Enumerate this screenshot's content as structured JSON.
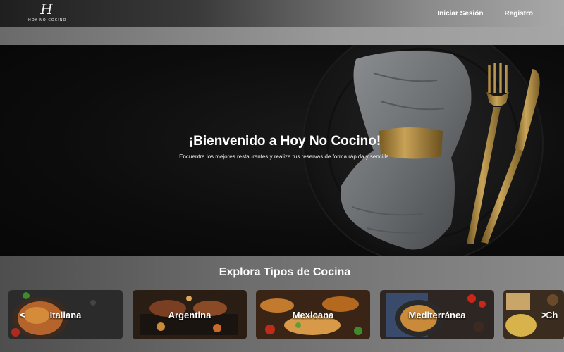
{
  "header": {
    "logo_mark": "H",
    "logo_text": "HOY NO COCINO",
    "nav": {
      "login_label": "Iniciar Sesión",
      "register_label": "Registro"
    }
  },
  "hero": {
    "title": "¡Bienvenido a Hoy No Cocino!",
    "subtitle": "Encuentra los mejores restaurantes y realiza tus reservas de forma rápida y sencilla."
  },
  "cuisines": {
    "section_title": "Explora Tipos de Cocina",
    "prev_label": "<",
    "next_label": ">",
    "items": [
      {
        "label": "Italiana"
      },
      {
        "label": "Argentina"
      },
      {
        "label": "Mexicana"
      },
      {
        "label": "Mediterránea"
      },
      {
        "label": "Ch"
      }
    ]
  },
  "colors": {
    "header_dark": "#1f1f1f",
    "header_light": "#a8a8a8",
    "hero_bg": "#0c0c0c",
    "text_white": "#ffffff"
  }
}
